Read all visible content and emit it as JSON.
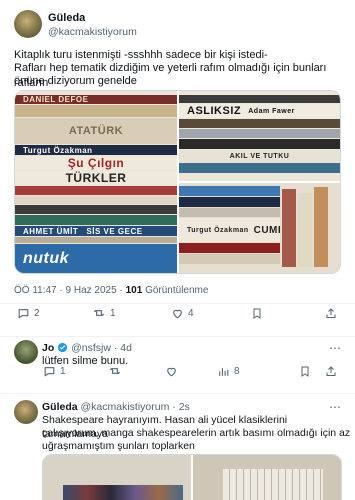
{
  "post": {
    "author_name": "Güleda",
    "author_handle": "@kacmakistiyorum",
    "text_line1": "Kitaplık turu istenmişti -ssshhh sadece bir kişi istedi-",
    "text_line2": "Rafları hep tematik dizdiğim ve yeterli rafım olmadığı için bunları rafların",
    "text_line3": "önüne diziyorum genelde",
    "time": "ÖÖ 11:47",
    "sep": "·",
    "date": "9 Haz 2025",
    "views_count": "101",
    "views_label": "Görüntülenme",
    "replies": "2",
    "reposts": "1",
    "likes": "4",
    "book_titles_left": [
      "DANIEL DEFOE",
      "ATATÜRK",
      "Turgut Özakman",
      "Şu Çılgın",
      "TÜRKLER",
      "AHMET ÜMİT",
      "SİS VE GECE",
      "nutuk"
    ],
    "book_titles_right_top": [
      "ASLIKSIZ",
      "Adam Fawer",
      "AKIL VE TUTKU"
    ],
    "book_titles_right_bottom": [
      "Turgut Özakman",
      "CUMHURİYET"
    ]
  },
  "reply1": {
    "author_name": "Jo",
    "author_handle": "@nsfsjw",
    "sep": "·",
    "age": "4d",
    "text": "lütfen silme bunu.",
    "replies": "1",
    "views": "8"
  },
  "reply2": {
    "author_name": "Güleda",
    "author_handle": "@kacmakistiyorum",
    "sep": "·",
    "age": "2s",
    "text_line1": "Shakespeare hayranıyım. Hasan ali yücel klasiklerini tamamlamaya",
    "text_line2": "çalışıyorum, manga shakespearelerin artık basımı olmadığı için az",
    "text_line3": "uğraşmamıştım şunları toplarken"
  },
  "colors": {
    "text": "#0f1419",
    "secondary": "#536471",
    "divider": "#eff3f4",
    "verified": "#1d9bf0"
  },
  "icons": [
    "reply-icon",
    "repost-icon",
    "like-icon",
    "bookmark-icon",
    "share-icon",
    "views-icon",
    "more-icon"
  ]
}
